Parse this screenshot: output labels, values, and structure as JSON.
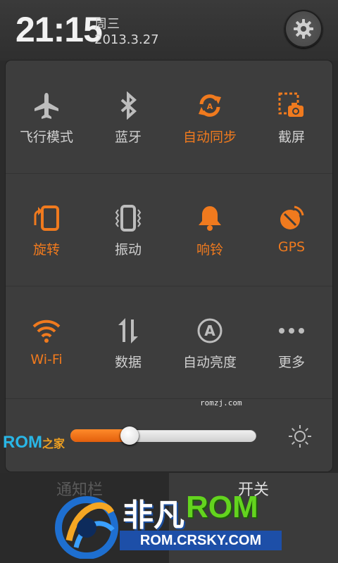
{
  "status": {
    "time": "21:15",
    "weekday": "周三",
    "date": "2013.3.27"
  },
  "toggles": [
    {
      "label": "飞行模式",
      "icon": "airplane-icon",
      "on": false
    },
    {
      "label": "蓝牙",
      "icon": "bluetooth-icon",
      "on": false
    },
    {
      "label": "自动同步",
      "icon": "sync-icon",
      "on": true
    },
    {
      "label": "截屏",
      "icon": "screenshot-icon",
      "on": false
    },
    {
      "label": "旋转",
      "icon": "rotate-icon",
      "on": true
    },
    {
      "label": "振动",
      "icon": "vibrate-icon",
      "on": false
    },
    {
      "label": "响铃",
      "icon": "bell-icon",
      "on": true
    },
    {
      "label": "GPS",
      "icon": "gps-icon",
      "on": true
    },
    {
      "label": "Wi-Fi",
      "icon": "wifi-icon",
      "on": true
    },
    {
      "label": "数据",
      "icon": "data-icon",
      "on": false
    },
    {
      "label": "自动亮度",
      "icon": "auto-brightness-icon",
      "on": false
    },
    {
      "label": "更多",
      "icon": "more-icon",
      "on": false
    }
  ],
  "brightness": {
    "level": 0.32
  },
  "watermarks": {
    "small": "romzj.com",
    "rom_logo": "ROM",
    "rom_logo_sub": "之家",
    "brand_1": "非凡",
    "brand_2": "ROM",
    "brand_url": "ROM.CRSKY.COM"
  },
  "bottom_tabs": {
    "left": "通知栏",
    "right": "开关"
  },
  "colors": {
    "accent": "#f07a1e",
    "inactive": "#d0d0d0",
    "panel": "#3d3d3d"
  }
}
